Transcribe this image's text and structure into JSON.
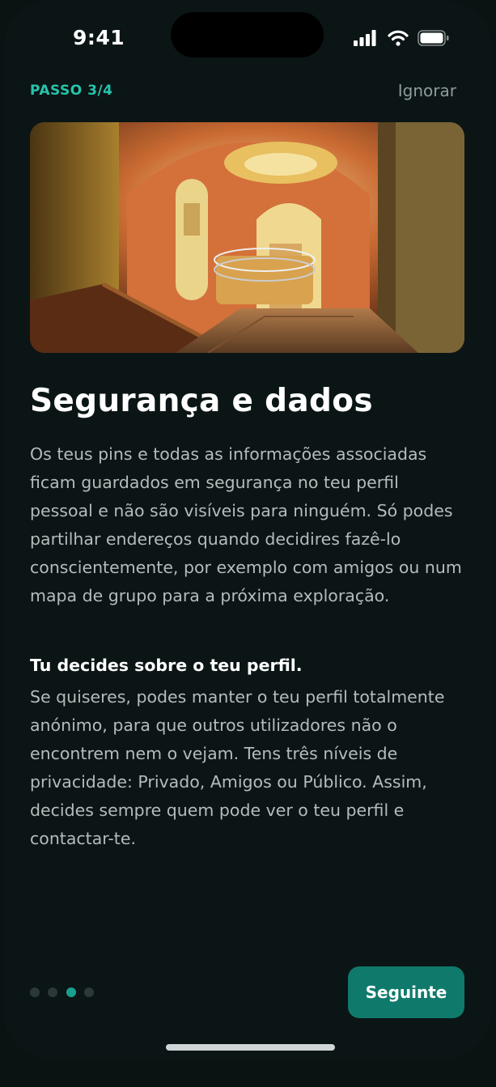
{
  "status_bar": {
    "time": "9:41",
    "icons": [
      "cellular-signal-icon",
      "wifi-icon",
      "battery-icon"
    ]
  },
  "header": {
    "step_label": "PASSO 3/4",
    "skip_label": "Ignorar"
  },
  "hero_image": {
    "description_icon": "hero-photo"
  },
  "content": {
    "title": "Segurança e dados",
    "paragraph_1": "Os teus pins e todas as informações associadas ficam guardados em segurança no teu perfil pessoal e não são visíveis para ninguém. Só podes partilhar endereços quando decidires fazê-lo conscientemente, por exemplo com amigos ou num mapa de grupo para a próxima exploração.",
    "subheading": "Tu decides sobre o teu perfil.",
    "paragraph_2": "Se quiseres, podes manter o teu perfil totalmente anónimo, para que outros utilizadores não o encontrem nem o vejam. Tens três níveis de privacidade: Privado, Amigos ou Público. Assim, decides sempre quem pode ver o teu perfil e contactar-te."
  },
  "pagination": {
    "total": 4,
    "current": 3
  },
  "footer": {
    "next_label": "Seguinte"
  },
  "colors": {
    "background": "#0b1515",
    "accent": "#26c4ac",
    "button": "#0f7a6c",
    "muted_text": "#b4bcbc"
  }
}
